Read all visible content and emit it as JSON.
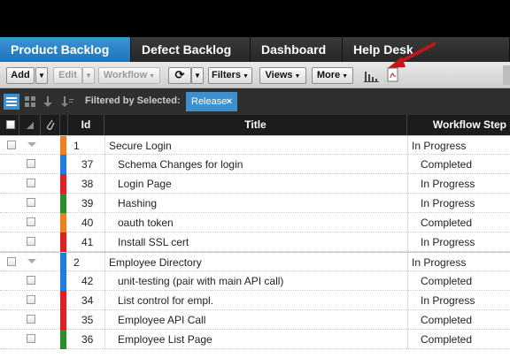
{
  "tabs": [
    {
      "label": "Product Backlog",
      "active": true
    },
    {
      "label": "Defect Backlog",
      "active": false
    },
    {
      "label": "Dashboard",
      "active": false
    },
    {
      "label": "Help Desk",
      "active": false
    }
  ],
  "toolbar": {
    "add_label": "Add",
    "edit_label": "Edit",
    "workflow_label": "Workflow",
    "filters_label": "Filters",
    "views_label": "Views",
    "more_label": "More"
  },
  "filterbar": {
    "label": "Filtered by Selected:",
    "chip_label": "Release",
    "chip_close": "×"
  },
  "grid": {
    "columns": {
      "id": "Id",
      "title": "Title",
      "workflow": "Workflow Step"
    }
  },
  "rows": [
    {
      "type": "parent",
      "id": "1",
      "title": "Secure Login",
      "status": "In Progress",
      "color": "#f07f1e"
    },
    {
      "type": "child",
      "id": "37",
      "title": "Schema Changes for login",
      "status": "Completed",
      "color": "#1e7ce0"
    },
    {
      "type": "child",
      "id": "38",
      "title": "Login Page",
      "status": "In Progress",
      "color": "#e02020"
    },
    {
      "type": "child",
      "id": "39",
      "title": "Hashing",
      "status": "In Progress",
      "color": "#2a8f2a"
    },
    {
      "type": "child",
      "id": "40",
      "title": "oauth token",
      "status": "Completed",
      "color": "#f07f1e"
    },
    {
      "type": "child",
      "id": "41",
      "title": "Install SSL cert",
      "status": "In Progress",
      "color": "#e02020"
    },
    {
      "type": "parent",
      "id": "2",
      "title": "Employee Directory",
      "status": "In Progress",
      "color": "#1e7ce0"
    },
    {
      "type": "child",
      "id": "42",
      "title": "unit-testing (pair with main API call)",
      "status": "Completed",
      "color": "#1e7ce0"
    },
    {
      "type": "child",
      "id": "34",
      "title": "List control for empl.",
      "status": "In Progress",
      "color": "#e02020"
    },
    {
      "type": "child",
      "id": "35",
      "title": "Employee API Call",
      "status": "Completed",
      "color": "#e02020"
    },
    {
      "type": "child",
      "id": "36",
      "title": "Employee List Page",
      "status": "Completed",
      "color": "#2a8f2a"
    }
  ]
}
